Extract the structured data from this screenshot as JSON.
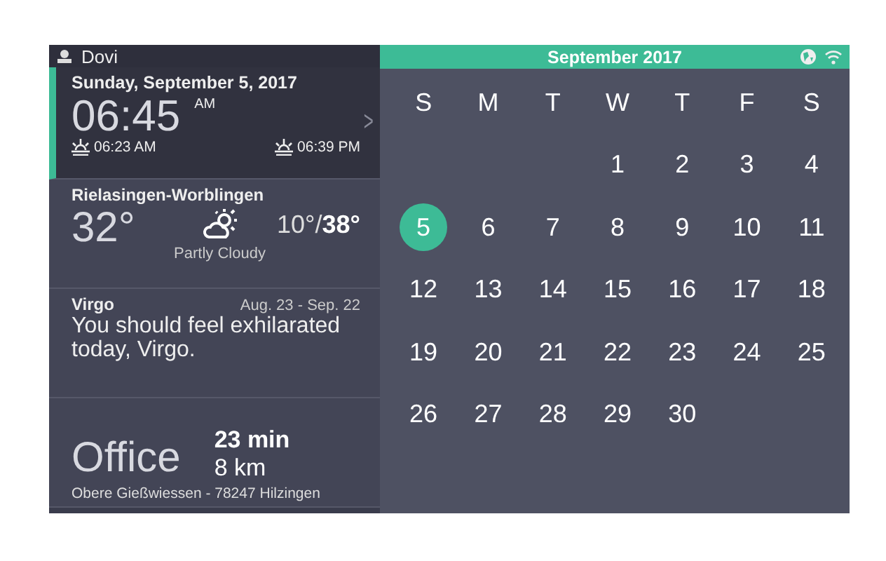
{
  "user": {
    "name": "Dovi"
  },
  "clock": {
    "date": "Sunday, September 5, 2017",
    "time": "06:45",
    "meridiem": "AM",
    "sunrise": "06:23 AM",
    "sunset": "06:39 PM",
    "next": ">"
  },
  "weather": {
    "place": "Rielasingen-Worblingen",
    "temperature": "32°",
    "low": "10°/",
    "high": "38°",
    "condition": "Partly Cloudy"
  },
  "horoscope": {
    "sign": "Virgo",
    "dates": "Aug. 23 - Sep. 22",
    "text": "You should feel exhilarated today, Virgo."
  },
  "commute": {
    "destination": "Office",
    "duration": "23 min",
    "distance": "8 km",
    "address": "Obere Gießwiessen - 78247 Hilzingen"
  },
  "calendar": {
    "title": "September 2017",
    "weekdays": [
      "S",
      "M",
      "T",
      "W",
      "T",
      "F",
      "S"
    ],
    "weeks": [
      [
        {
          "day": "1",
          "selected": false
        },
        {
          "day": "2",
          "selected": false
        },
        {
          "day": "3",
          "selected": false
        },
        {
          "day": "4",
          "selected": false
        }
      ],
      [
        {
          "day": "5",
          "selected": true
        },
        {
          "day": "6",
          "selected": false
        },
        {
          "day": "7",
          "selected": false
        },
        {
          "day": "8",
          "selected": false
        },
        {
          "day": "9",
          "selected": false
        },
        {
          "day": "10",
          "selected": false
        },
        {
          "day": "11",
          "selected": false
        }
      ],
      [
        {
          "day": "12",
          "selected": false
        },
        {
          "day": "13",
          "selected": false
        },
        {
          "day": "14",
          "selected": false
        },
        {
          "day": "15",
          "selected": false
        },
        {
          "day": "16",
          "selected": false
        },
        {
          "day": "17",
          "selected": false
        },
        {
          "day": "18",
          "selected": false
        }
      ],
      [
        {
          "day": "19",
          "selected": false
        },
        {
          "day": "20",
          "selected": false
        },
        {
          "day": "21",
          "selected": false
        },
        {
          "day": "22",
          "selected": false
        },
        {
          "day": "23",
          "selected": false
        },
        {
          "day": "24",
          "selected": false
        },
        {
          "day": "25",
          "selected": false
        }
      ],
      [
        {
          "day": "26",
          "selected": false
        },
        {
          "day": "27",
          "selected": false
        },
        {
          "day": "28",
          "selected": false
        },
        {
          "day": "29",
          "selected": false
        },
        {
          "day": "30",
          "selected": false
        }
      ]
    ]
  }
}
